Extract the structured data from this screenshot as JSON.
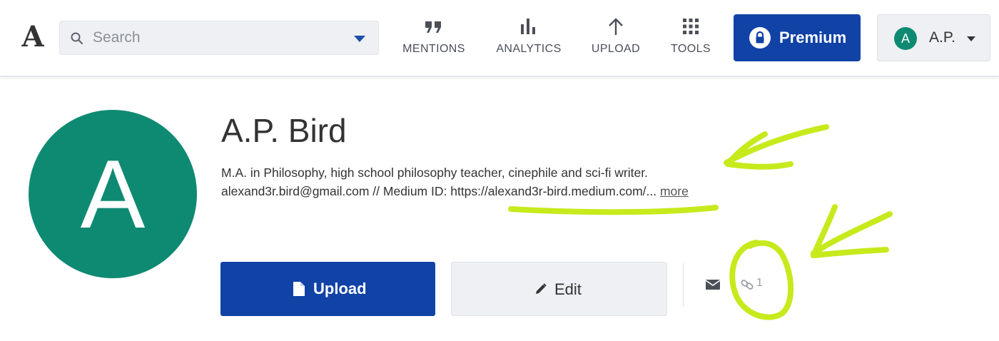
{
  "header": {
    "logo_letter": "A",
    "search": {
      "placeholder": "Search",
      "value": ""
    },
    "nav": [
      {
        "label": "MENTIONS",
        "icon": "quote-icon"
      },
      {
        "label": "ANALYTICS",
        "icon": "bar-chart-icon"
      },
      {
        "label": "UPLOAD",
        "icon": "arrow-up-icon"
      },
      {
        "label": "TOOLS",
        "icon": "grid-icon"
      }
    ],
    "premium": {
      "label": "Premium",
      "icon": "lock-icon"
    },
    "user": {
      "initial": "A",
      "name": "A.P."
    }
  },
  "profile": {
    "avatar_initial": "A",
    "name": "A.P. Bird",
    "bio_line_1": "M.A. in Philosophy, high school philosophy teacher, cinephile and sci-fi writer.",
    "bio_line_2": "alexand3r.bird@gmail.com // Medium ID: https://alexand3r-bird.medium.com/...",
    "more_label": "more",
    "actions": {
      "upload_label": "Upload",
      "edit_label": "Edit"
    },
    "link_count": "1"
  },
  "colors": {
    "brand_blue": "#1142a6",
    "avatar_green": "#0f8a72",
    "annotation_green": "#c6ea1c"
  }
}
